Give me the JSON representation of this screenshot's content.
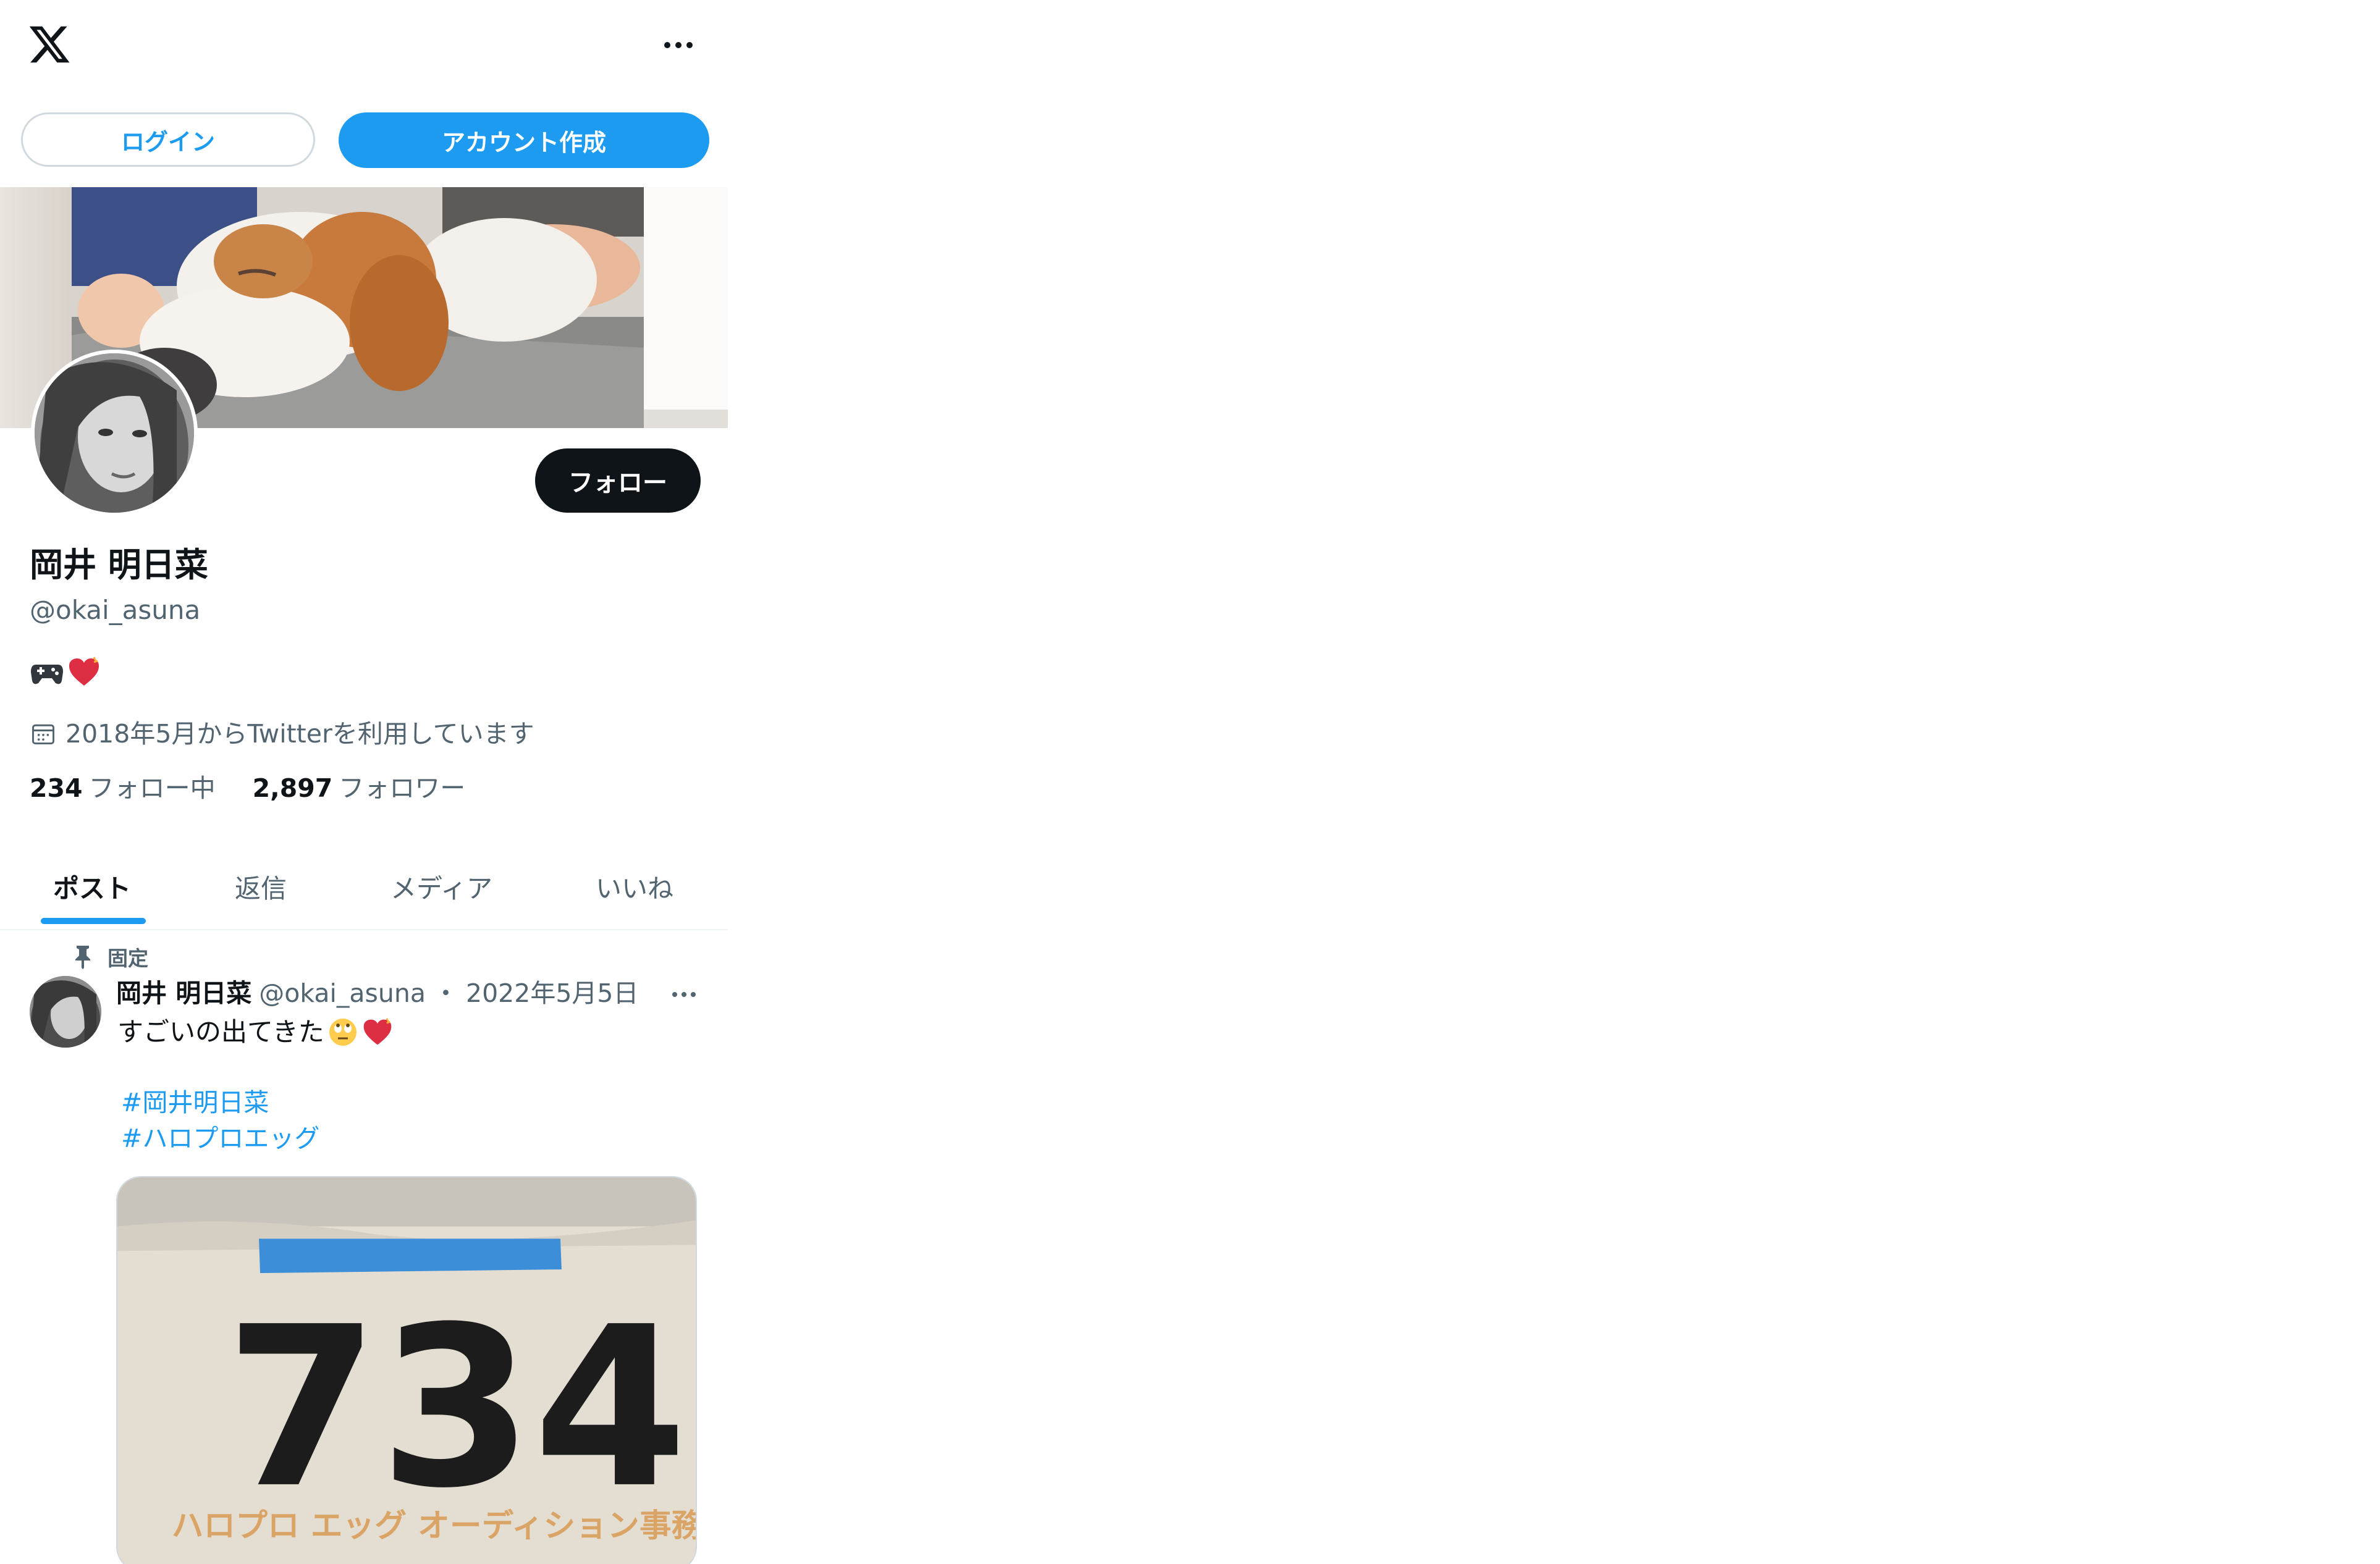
{
  "header": {
    "logo_icon": "x-logo-icon",
    "more_icon": "more-horizontal-icon"
  },
  "auth": {
    "login_label": "ログイン",
    "signup_label": "アカウント作成"
  },
  "profile": {
    "follow_label": "フォロー",
    "display_name": "岡井 明日菜",
    "handle": "@okai_asuna",
    "bio_icons": [
      "game-controller-icon",
      "heart-icon"
    ],
    "joined_text": "2018年5月からTwitterを利用しています",
    "following_count": "234",
    "following_label": "フォロー中",
    "followers_count": "2,897",
    "followers_label": "フォロワー"
  },
  "tabs": [
    {
      "label": "ポスト",
      "active": true
    },
    {
      "label": "返信",
      "active": false
    },
    {
      "label": "メディア",
      "active": false
    },
    {
      "label": "いいね",
      "active": false
    }
  ],
  "tweet": {
    "pinned_label": "固定",
    "author_name": "岡井 明日菜",
    "author_handle": "@okai_asuna",
    "separator": "・",
    "date": "2022年5月5日",
    "text": "すごいの出てきた",
    "text_icons": [
      "face-with-rolling-eyes-icon",
      "heart-icon"
    ],
    "hashtags": [
      "#岡井明日菜",
      "#ハロプロエッグ"
    ],
    "media": {
      "number_text": "734",
      "caption_text": "ハロプロ エッグ オーディション事務局"
    }
  },
  "colors": {
    "accent": "#1d9bf0",
    "text": "#0f1419",
    "secondary": "#536471",
    "border": "#cfd9de"
  }
}
